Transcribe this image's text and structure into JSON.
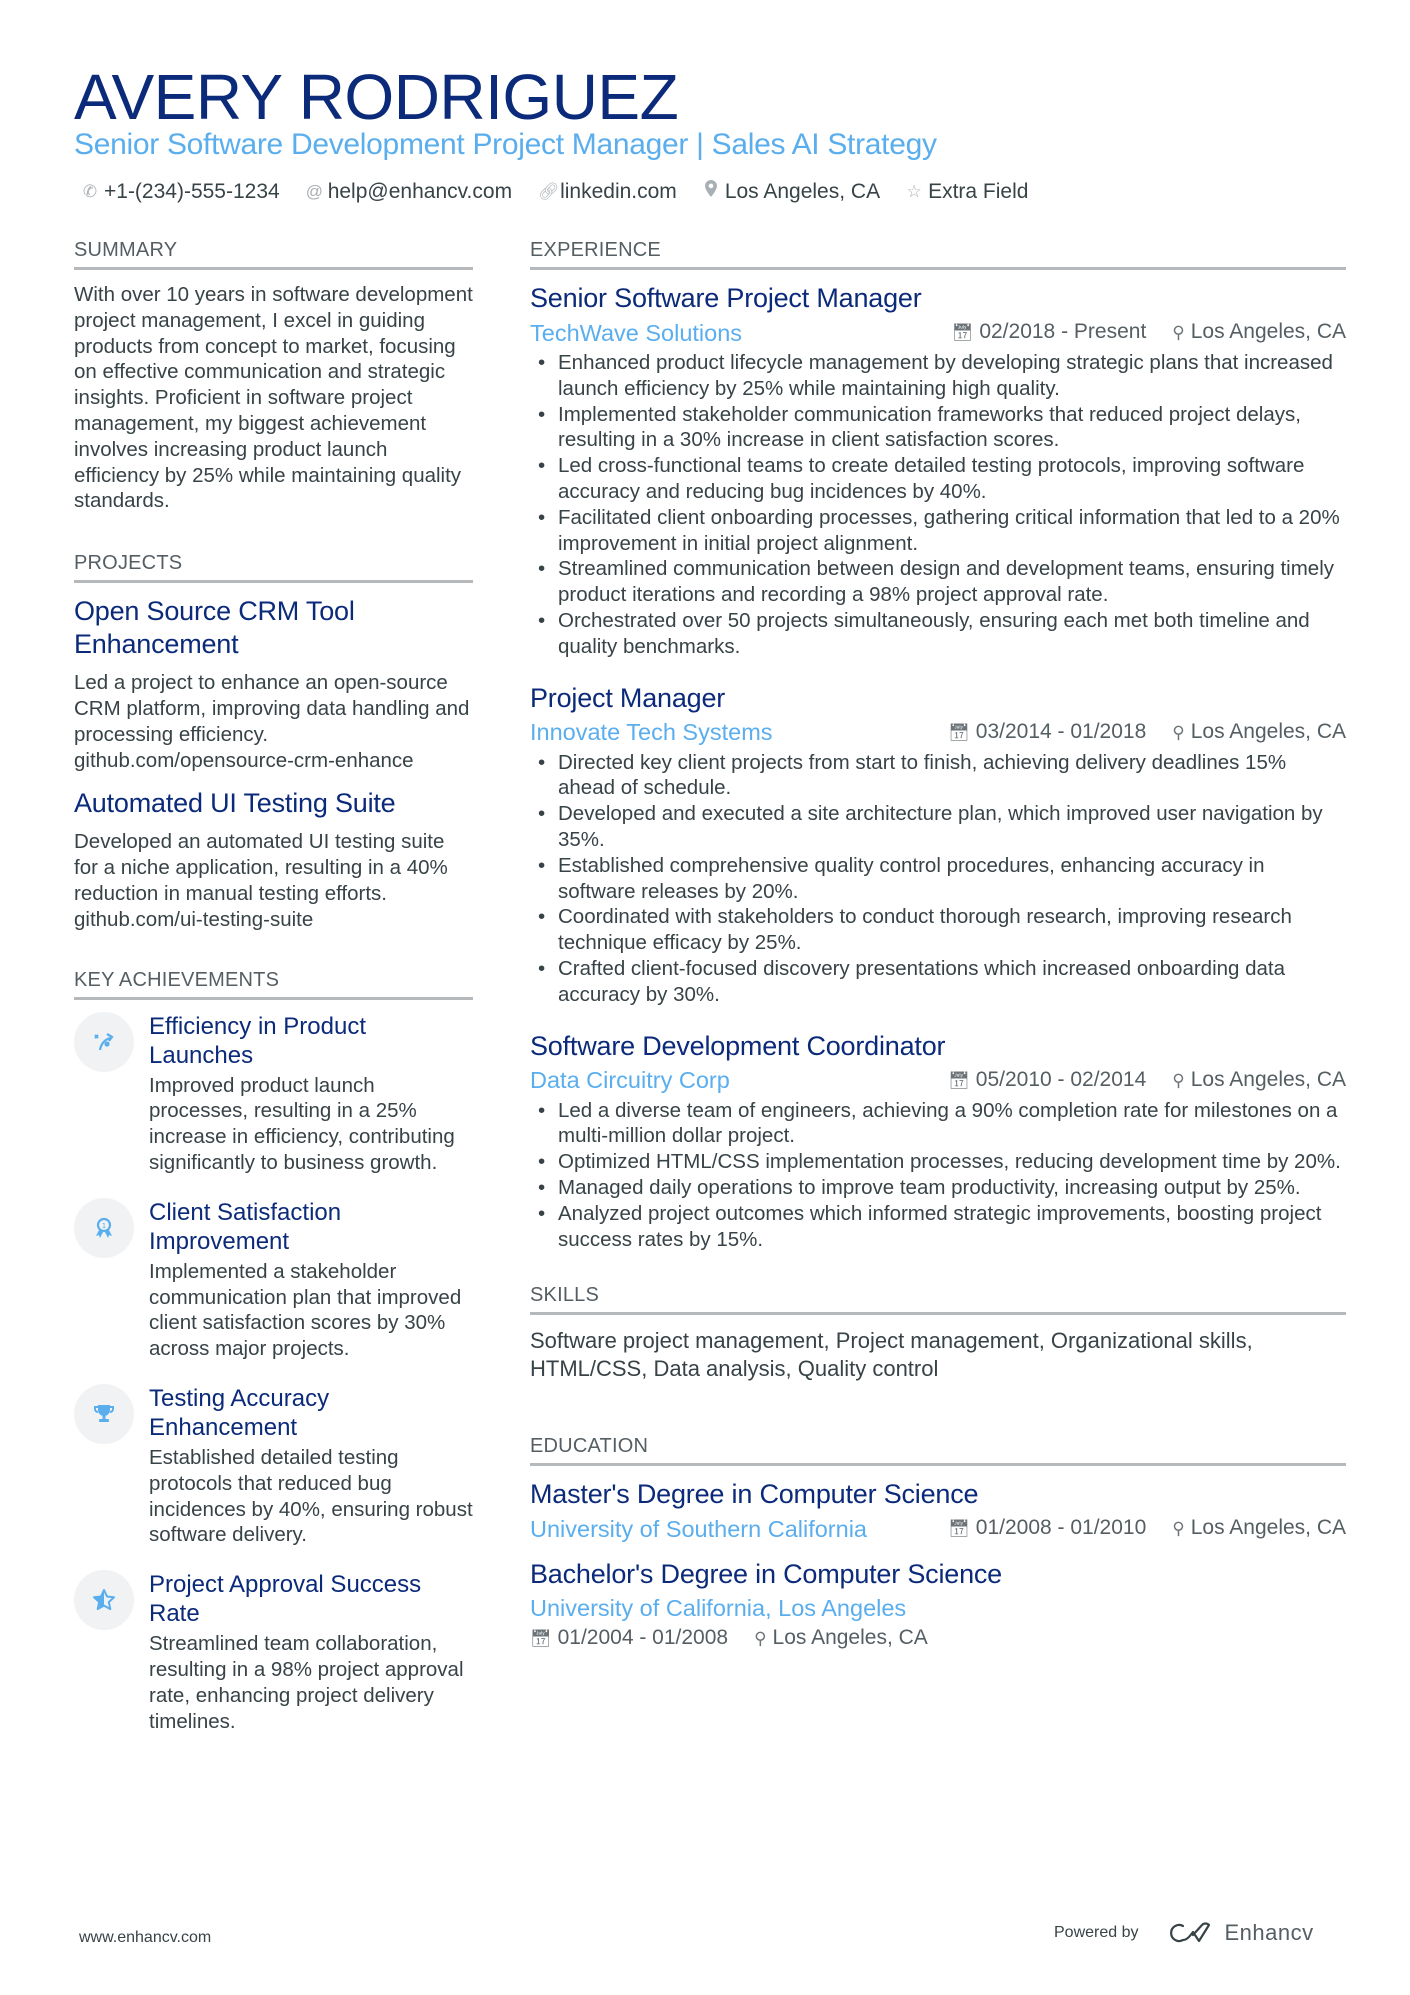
{
  "header": {
    "name": "AVERY RODRIGUEZ",
    "headline": "Senior Software Development Project Manager | Sales AI Strategy",
    "contacts": [
      {
        "icon": "phone-icon",
        "text": "+1-(234)-555-1234"
      },
      {
        "icon": "at-icon",
        "text": "help@enhancv.com"
      },
      {
        "icon": "link-icon",
        "text": "linkedin.com"
      },
      {
        "icon": "location-icon",
        "text": "Los Angeles, CA"
      },
      {
        "icon": "star-icon",
        "text": "Extra Field"
      }
    ]
  },
  "summary": {
    "title": "SUMMARY",
    "text": "With over 10 years in software development project management, I excel in guiding products from concept to market, focusing on effective communication and strategic insights. Proficient in software project management, my biggest achievement involves increasing product launch efficiency by 25% while maintaining quality standards."
  },
  "projects": {
    "title": "PROJECTS",
    "items": [
      {
        "title": "Open Source CRM Tool Enhancement",
        "description": "Led a project to enhance an open-source CRM platform, improving data handling and processing efficiency. github.com/opensource-crm-enhance"
      },
      {
        "title": "Automated UI Testing Suite",
        "description": "Developed an automated UI testing suite for a niche application, resulting in a 40% reduction in manual testing efforts. github.com/ui-testing-suite"
      }
    ]
  },
  "achievements": {
    "title": "KEY ACHIEVEMENTS",
    "items": [
      {
        "icon": "strategy-arrow-icon",
        "title": "Efficiency in Product Launches",
        "description": "Improved product launch processes, resulting in a 25% increase in efficiency, contributing significantly to business growth."
      },
      {
        "icon": "award-ribbon-icon",
        "title": "Client Satisfaction Improvement",
        "description": "Implemented a stakeholder communication plan that improved client satisfaction scores by 30% across major projects."
      },
      {
        "icon": "trophy-icon",
        "title": "Testing Accuracy Enhancement",
        "description": "Established detailed testing protocols that reduced bug incidences by 40%, ensuring robust software delivery."
      },
      {
        "icon": "half-star-icon",
        "title": "Project Approval Success Rate",
        "description": "Streamlined team collaboration, resulting in a 98% project approval rate, enhancing project delivery timelines."
      }
    ]
  },
  "experience": {
    "title": "EXPERIENCE",
    "jobs": [
      {
        "role": "Senior Software Project Manager",
        "company": "TechWave Solutions",
        "dates": "02/2018 - Present",
        "location": "Los Angeles, CA",
        "bullets": [
          "Enhanced product lifecycle management by developing strategic plans that increased launch efficiency by 25% while maintaining high quality.",
          "Implemented stakeholder communication frameworks that reduced project delays, resulting in a 30% increase in client satisfaction scores.",
          "Led cross-functional teams to create detailed testing protocols, improving software accuracy and reducing bug incidences by 40%.",
          "Facilitated client onboarding processes, gathering critical information that led to a 20% improvement in initial project alignment.",
          "Streamlined communication between design and development teams, ensuring timely product iterations and recording a 98% project approval rate.",
          "Orchestrated over 50 projects simultaneously, ensuring each met both timeline and quality benchmarks."
        ]
      },
      {
        "role": "Project Manager",
        "company": "Innovate Tech Systems",
        "dates": "03/2014 - 01/2018",
        "location": "Los Angeles, CA",
        "bullets": [
          "Directed key client projects from start to finish, achieving delivery deadlines 15% ahead of schedule.",
          "Developed and executed a site architecture plan, which improved user navigation by 35%.",
          "Established comprehensive quality control procedures, enhancing accuracy in software releases by 20%.",
          "Coordinated with stakeholders to conduct thorough research, improving research technique efficacy by 25%.",
          "Crafted client-focused discovery presentations which increased onboarding data accuracy by 30%."
        ]
      },
      {
        "role": "Software Development Coordinator",
        "company": "Data Circuitry Corp",
        "dates": "05/2010 - 02/2014",
        "location": "Los Angeles, CA",
        "bullets": [
          "Led a diverse team of engineers, achieving a 90% completion rate for milestones on a multi-million dollar project.",
          "Optimized HTML/CSS implementation processes, reducing development time by 20%.",
          "Managed daily operations to improve team productivity, increasing output by 25%.",
          "Analyzed project outcomes which informed strategic improvements, boosting project success rates by 15%."
        ]
      }
    ]
  },
  "skills": {
    "title": "SKILLS",
    "text": "Software project management, Project management, Organizational skills, HTML/CSS, Data analysis, Quality control"
  },
  "education": {
    "title": "EDUCATION",
    "items": [
      {
        "degree": "Master's Degree in Computer Science",
        "school": "University of Southern California",
        "dates": "01/2008 - 01/2010",
        "location": "Los Angeles, CA"
      },
      {
        "degree": "Bachelor's Degree in Computer Science",
        "school": "University of California, Los Angeles",
        "dates": "01/2004 - 01/2008",
        "location": "Los Angeles, CA"
      }
    ]
  },
  "footer": {
    "website": "www.enhancv.com",
    "powered_by": "Powered by",
    "brand": "Enhancv"
  },
  "colors": {
    "name": "#0b2a7a",
    "accent": "#5aaeee",
    "text": "#384347",
    "rule": "#b5b9bc",
    "icon_bg": "#f1f2f3"
  }
}
